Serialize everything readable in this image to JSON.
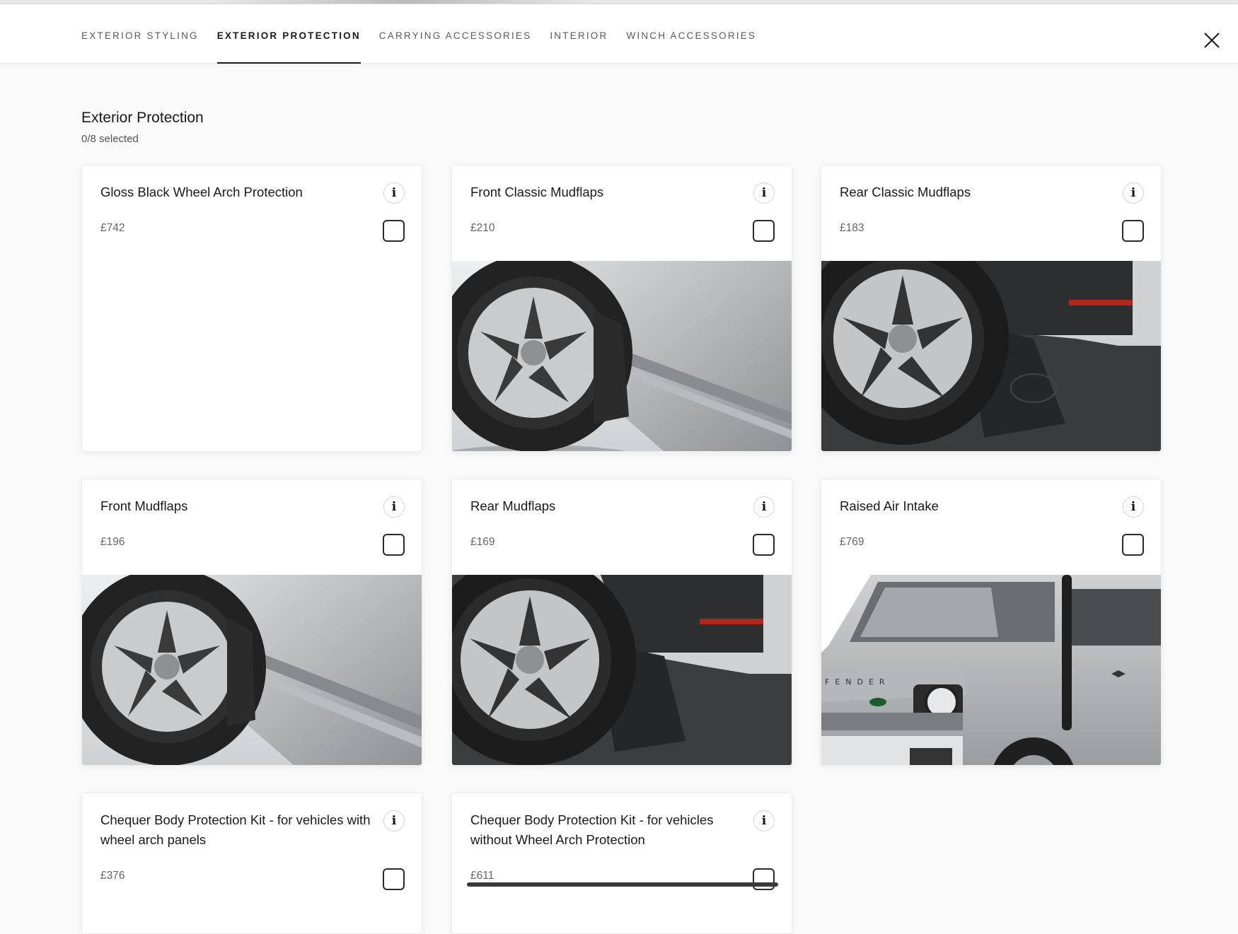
{
  "tabs": [
    {
      "label": "EXTERIOR STYLING",
      "active": false
    },
    {
      "label": "EXTERIOR PROTECTION",
      "active": true
    },
    {
      "label": "CARRYING ACCESSORIES",
      "active": false
    },
    {
      "label": "INTERIOR",
      "active": false
    },
    {
      "label": "WINCH ACCESSORIES",
      "active": false
    }
  ],
  "section": {
    "title": "Exterior Protection",
    "count": "0/8 selected"
  },
  "products": [
    {
      "name": "Gloss Black Wheel Arch Protection",
      "price": "£742",
      "image": "none"
    },
    {
      "name": "Front Classic Mudflaps",
      "price": "£210",
      "image": "front-wheel-mudflap"
    },
    {
      "name": "Rear Classic Mudflaps",
      "price": "£183",
      "image": "rear-wheel-mudflap-logo"
    },
    {
      "name": "Front Mudflaps",
      "price": "£196",
      "image": "front-wheel-mudflap"
    },
    {
      "name": "Rear Mudflaps",
      "price": "£169",
      "image": "rear-wheel-mudflap"
    },
    {
      "name": "Raised Air Intake",
      "price": "£769",
      "image": "vehicle-front-snorkel"
    },
    {
      "name": "Chequer Body Protection Kit - for vehicles with wheel arch panels",
      "price": "£376",
      "image": "none"
    },
    {
      "name": "Chequer Body Protection Kit - for vehicles without Wheel Arch Protection",
      "price": "£611",
      "image": "none"
    }
  ],
  "icons": {
    "info": "info-icon",
    "close": "close-icon",
    "checkbox": "checkbox-unchecked"
  },
  "colors": {
    "background": "#f9f9f9",
    "card": "#ffffff",
    "text": "#1a1a1a",
    "muted": "#666666"
  }
}
